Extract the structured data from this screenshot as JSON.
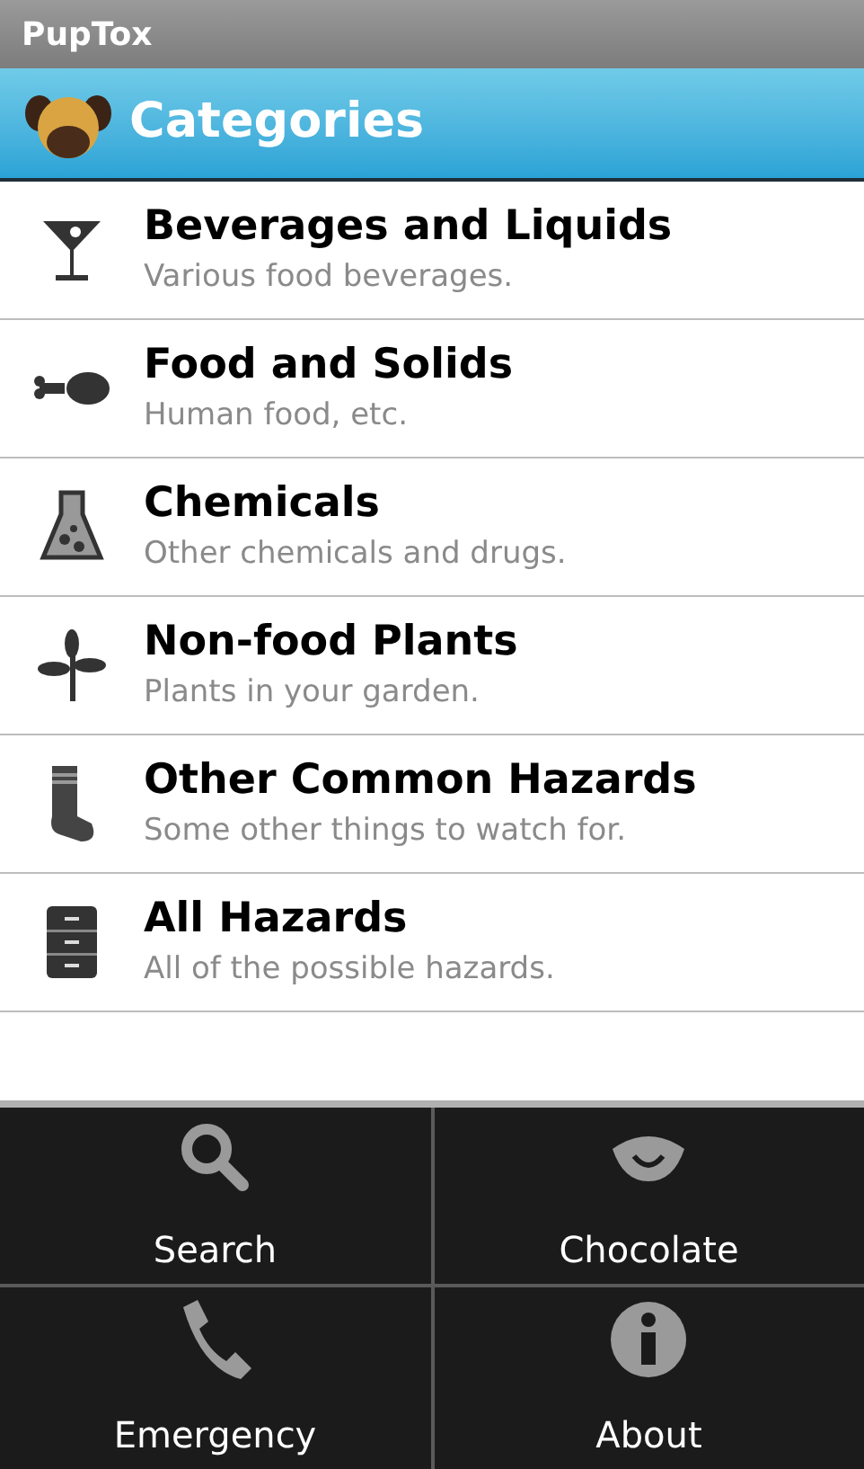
{
  "window": {
    "title": "PupTox"
  },
  "header": {
    "title": "Categories"
  },
  "categories": [
    {
      "title": "Beverages and Liquids",
      "subtitle": "Various food beverages."
    },
    {
      "title": "Food and Solids",
      "subtitle": "Human food, etc."
    },
    {
      "title": "Chemicals",
      "subtitle": "Other chemicals and drugs."
    },
    {
      "title": "Non-food Plants",
      "subtitle": "Plants in your garden."
    },
    {
      "title": "Other Common Hazards",
      "subtitle": "Some other things to watch for."
    },
    {
      "title": "All Hazards",
      "subtitle": "All of the possible hazards."
    }
  ],
  "menu": [
    {
      "label": "Search"
    },
    {
      "label": "Chocolate"
    },
    {
      "label": "Emergency"
    },
    {
      "label": "About"
    }
  ]
}
